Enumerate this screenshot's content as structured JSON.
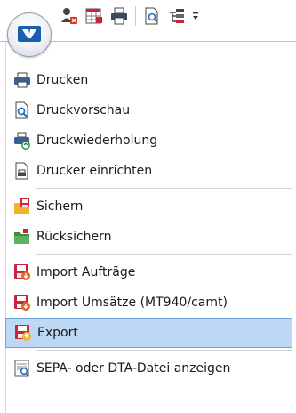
{
  "quick_access": {
    "icons": [
      "user-delete-icon",
      "spreadsheet-icon",
      "printer-icon",
      "print-preview-icon",
      "tree-icon",
      "more-icon"
    ]
  },
  "menu": {
    "items": [
      {
        "label": "Drucken",
        "icon": "printer-icon"
      },
      {
        "label": "Druckvorschau",
        "icon": "print-preview-icon"
      },
      {
        "label": "Druckwiederholung",
        "icon": "reprint-icon"
      },
      {
        "label": "Drucker einrichten",
        "icon": "printer-setup-icon"
      },
      {
        "label": "Sichern",
        "icon": "backup-icon"
      },
      {
        "label": "Rücksichern",
        "icon": "restore-icon"
      },
      {
        "label": "Import Aufträge",
        "icon": "import-orders-icon"
      },
      {
        "label": "Import Umsätze (MT940/camt)",
        "icon": "import-transactions-icon"
      },
      {
        "label": "Export",
        "icon": "export-icon",
        "highlighted": true
      },
      {
        "label": "SEPA- oder DTA-Datei anzeigen",
        "icon": "sepa-file-icon"
      }
    ]
  },
  "colors": {
    "highlight_bg": "#bcd8f4",
    "highlight_border": "#6fa3db",
    "brand_blue": "#1b5fb0",
    "import_red": "#c8243a"
  }
}
